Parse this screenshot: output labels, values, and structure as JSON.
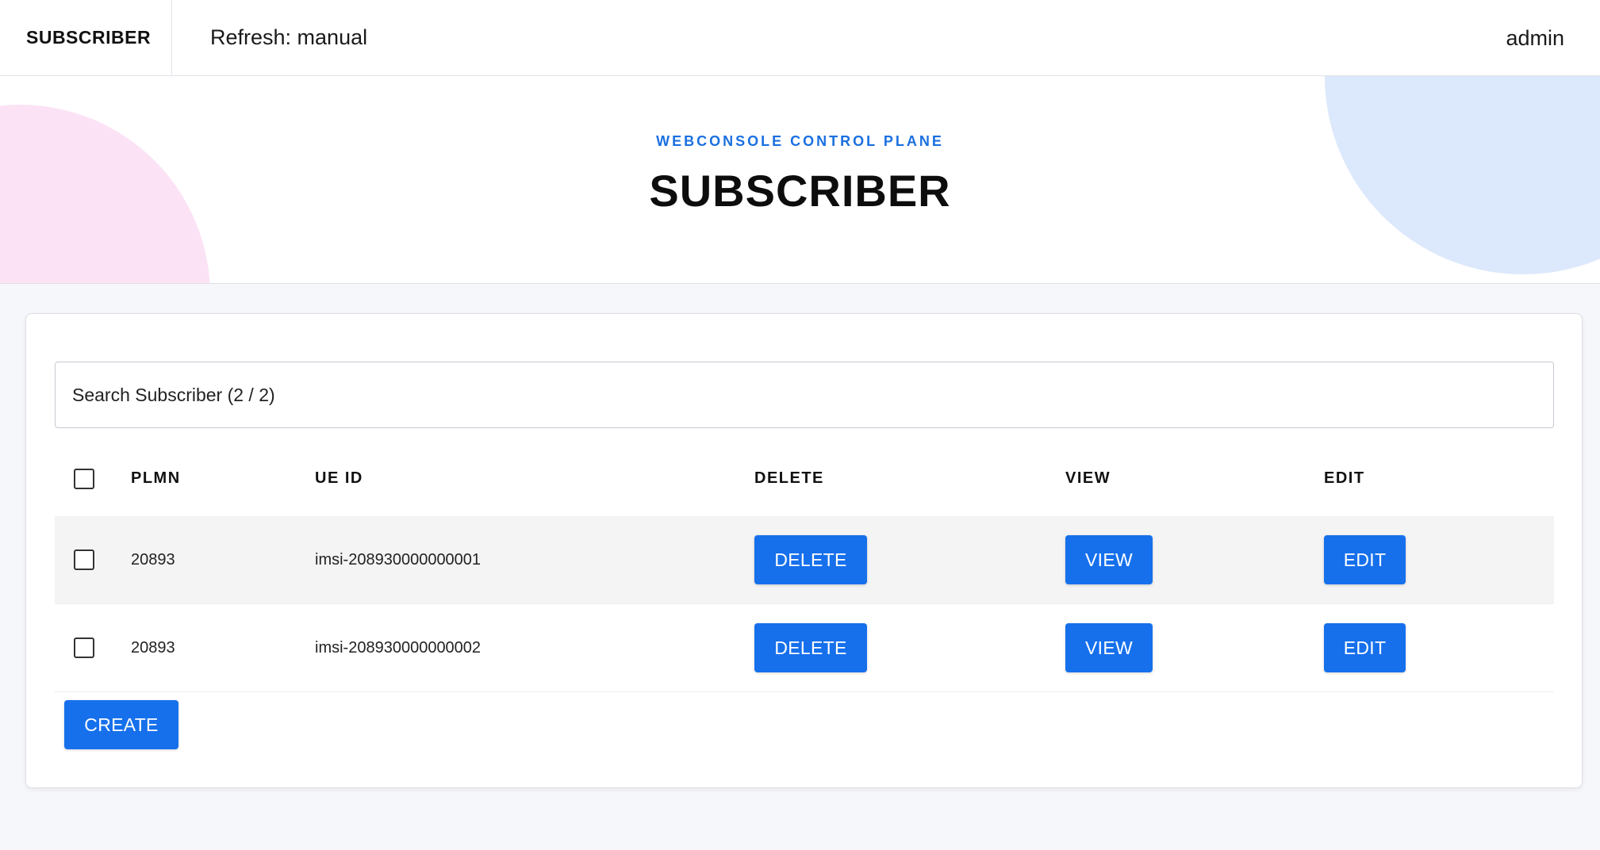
{
  "topbar": {
    "brand": "SUBSCRIBER",
    "refresh": "Refresh: manual",
    "user": "admin"
  },
  "hero": {
    "eyebrow": "WEBCONSOLE CONTROL PLANE",
    "title": "SUBSCRIBER"
  },
  "search": {
    "placeholder": "Search Subscriber (2 / 2)"
  },
  "table": {
    "headers": {
      "plmn": "PLMN",
      "ue_id": "UE ID",
      "delete": "DELETE",
      "view": "VIEW",
      "edit": "EDIT"
    },
    "rows": [
      {
        "plmn": "20893",
        "ue_id": "imsi-208930000000001",
        "delete_label": "DELETE",
        "view_label": "VIEW",
        "edit_label": "EDIT"
      },
      {
        "plmn": "20893",
        "ue_id": "imsi-208930000000002",
        "delete_label": "DELETE",
        "view_label": "VIEW",
        "edit_label": "EDIT"
      }
    ]
  },
  "actions": {
    "create_label": "CREATE"
  },
  "colors": {
    "accent": "#1670ec",
    "eyebrow": "#1a6fe0",
    "blob_pink": "#fbe3f5",
    "blob_blue": "#dce8fb",
    "row_shade": "#f4f4f4"
  },
  "icons": {
    "checkbox": "checkbox-empty-icon"
  }
}
